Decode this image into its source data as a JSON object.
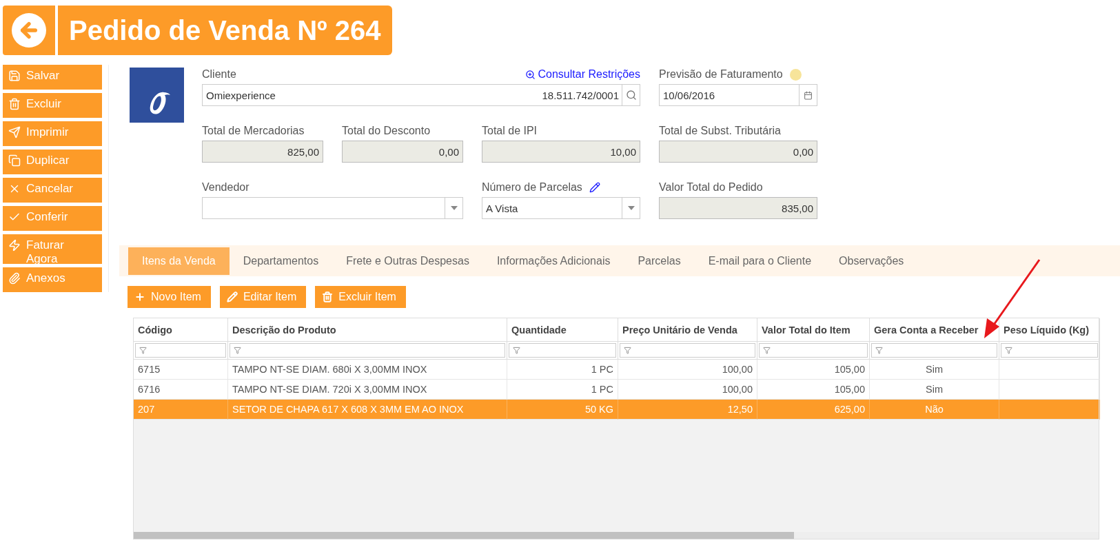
{
  "header": {
    "title": "Pedido de Venda Nº 264"
  },
  "sidebar": {
    "items": [
      {
        "kind": "save",
        "label": "Salvar"
      },
      {
        "kind": "delete",
        "label": "Excluir"
      },
      {
        "kind": "print",
        "label": "Imprimir"
      },
      {
        "kind": "duplicate",
        "label": "Duplicar"
      },
      {
        "kind": "cancel",
        "label": "Cancelar"
      },
      {
        "kind": "check",
        "label": "Conferir"
      },
      {
        "kind": "bill",
        "label": "Faturar Agora"
      },
      {
        "kind": "attach",
        "label": "Anexos"
      }
    ]
  },
  "form": {
    "cliente": {
      "label": "Cliente",
      "link": "Consultar Restrições",
      "value": "Omiexperience",
      "document": "18.511.742/0001"
    },
    "previsao": {
      "label": "Previsão de Faturamento",
      "value": "10/06/2016"
    },
    "totals": [
      {
        "label": "Total de Mercadorias",
        "value": "825,00"
      },
      {
        "label": "Total do Desconto",
        "value": "0,00"
      },
      {
        "label": "Total de IPI",
        "value": "10,00"
      },
      {
        "label": "Total de Subst. Tributária",
        "value": "0,00"
      }
    ],
    "vendedor": {
      "label": "Vendedor"
    },
    "parcelas": {
      "label": "Número de Parcelas",
      "value": "A Vista"
    },
    "valor_total": {
      "label": "Valor Total do Pedido",
      "value": "835,00"
    }
  },
  "tabs": [
    {
      "label": "Itens da Venda",
      "selected": true
    },
    {
      "label": "Departamentos",
      "selected": false
    },
    {
      "label": "Frete e Outras Despesas",
      "selected": false
    },
    {
      "label": "Informações Adicionais",
      "selected": false
    },
    {
      "label": "Parcelas",
      "selected": false
    },
    {
      "label": "E-mail para o Cliente",
      "selected": false
    },
    {
      "label": "Observações",
      "selected": false
    }
  ],
  "toolbar": [
    {
      "kind": "add",
      "label": "Novo Item"
    },
    {
      "kind": "edit",
      "label": "Editar Item"
    },
    {
      "kind": "delete",
      "label": "Excluir Item"
    }
  ],
  "table": {
    "columns": [
      {
        "label": "Código"
      },
      {
        "label": "Descrição do Produto"
      },
      {
        "label": "Quantidade"
      },
      {
        "label": "Preço Unitário de Venda"
      },
      {
        "label": "Valor Total do Item"
      },
      {
        "label": "Gera Conta a Receber"
      },
      {
        "label": "Peso Líquido (Kg)"
      }
    ],
    "rows": [
      {
        "selected": false,
        "cells": [
          "6715",
          "TAMPO NT-SE DIAM. 680i X 3,00MM INOX",
          "1 PC",
          "100,00",
          "105,00",
          "Sim"
        ]
      },
      {
        "selected": false,
        "cells": [
          "6716",
          "TAMPO NT-SE DIAM. 720i X 3,00MM INOX",
          "1 PC",
          "100,00",
          "105,00",
          "Sim"
        ]
      },
      {
        "selected": true,
        "cells": [
          "207",
          "SETOR DE CHAPA 617 X 608 X 3MM EM AO INOX",
          "50 KG",
          "12,50",
          "625,00",
          "Não"
        ]
      }
    ]
  }
}
